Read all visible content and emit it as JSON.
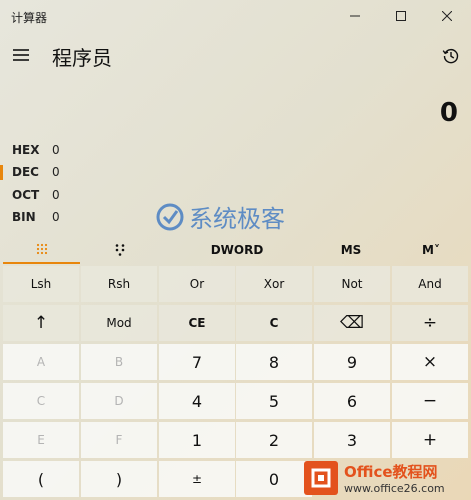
{
  "window": {
    "title": "计算器"
  },
  "header": {
    "mode_title": "程序员"
  },
  "display": {
    "value": "0"
  },
  "radix": [
    {
      "name": "HEX",
      "value": "0",
      "active": false
    },
    {
      "name": "DEC",
      "value": "0",
      "active": true
    },
    {
      "name": "OCT",
      "value": "0",
      "active": false
    },
    {
      "name": "BIN",
      "value": "0",
      "active": false
    }
  ],
  "tabs": {
    "word_size": "DWORD",
    "memory_store": "MS",
    "memory_menu": "M˅"
  },
  "keys": {
    "lsh": "Lsh",
    "rsh": "Rsh",
    "or": "Or",
    "xor": "Xor",
    "not": "Not",
    "and": "And",
    "shift_up": "↑",
    "mod": "Mod",
    "ce": "CE",
    "c": "C",
    "backspace": "⌫",
    "divide": "÷",
    "a": "A",
    "b": "B",
    "seven": "7",
    "eight": "8",
    "nine": "9",
    "multiply": "×",
    "c_hex": "C",
    "d": "D",
    "four": "4",
    "five": "5",
    "six": "6",
    "minus": "−",
    "e": "E",
    "f": "F",
    "one": "1",
    "two": "2",
    "three": "3",
    "plus": "+",
    "lparen": "(",
    "rparen": ")",
    "negate": "±",
    "zero": "0"
  },
  "watermark": {
    "text": "系统极客"
  },
  "badge": {
    "main": "Office教程网",
    "sub": "www.office26.com"
  },
  "colors": {
    "accent": "#e8860c",
    "watermark": "#3d78c2",
    "badge": "#e3521d"
  }
}
